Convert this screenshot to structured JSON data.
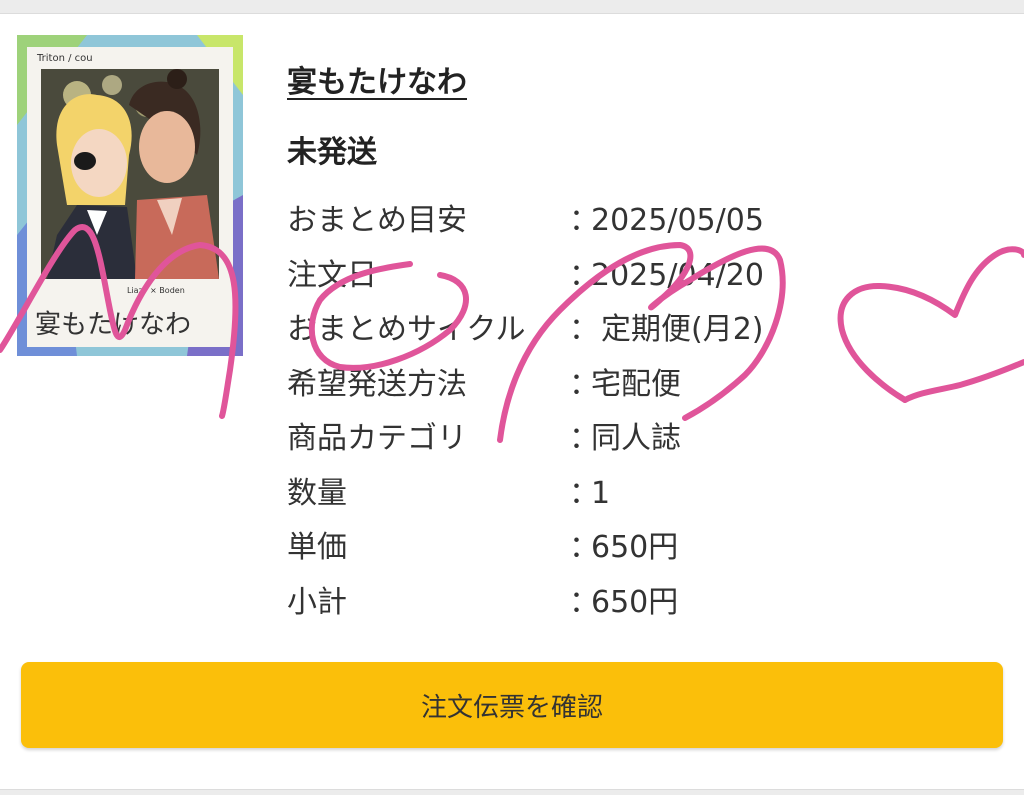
{
  "product": {
    "cover_alt": "宴もたけなわ cover",
    "cover_title_text": "宴もたけなわ",
    "cover_top_text": "Triton / cou",
    "cover_credit_text": "Liazy × Boden",
    "title": "宴もたけなわ",
    "status": "未発送"
  },
  "details": [
    {
      "label": "おまとめ目安",
      "colon": "：",
      "value": "2025/05/05"
    },
    {
      "label": "注文日",
      "colon": "：",
      "value": "2025/04/20"
    },
    {
      "label": "おまとめサイクル",
      "colon": "：",
      "value": "定期便(月2)"
    },
    {
      "label": "希望発送方法",
      "colon": "：",
      "value": "宅配便"
    },
    {
      "label": "商品カテゴリ",
      "colon": "：",
      "value": "同人誌"
    },
    {
      "label": "数量",
      "colon": "：",
      "value": "1"
    },
    {
      "label": "単価",
      "colon": "：",
      "value": "650円"
    },
    {
      "label": "小計",
      "colon": "：",
      "value": "650円"
    }
  ],
  "actions": {
    "confirm_label": "注文伝票を確認"
  },
  "colors": {
    "button_bg": "#fbbf0a",
    "scribble": "#e0559a"
  }
}
